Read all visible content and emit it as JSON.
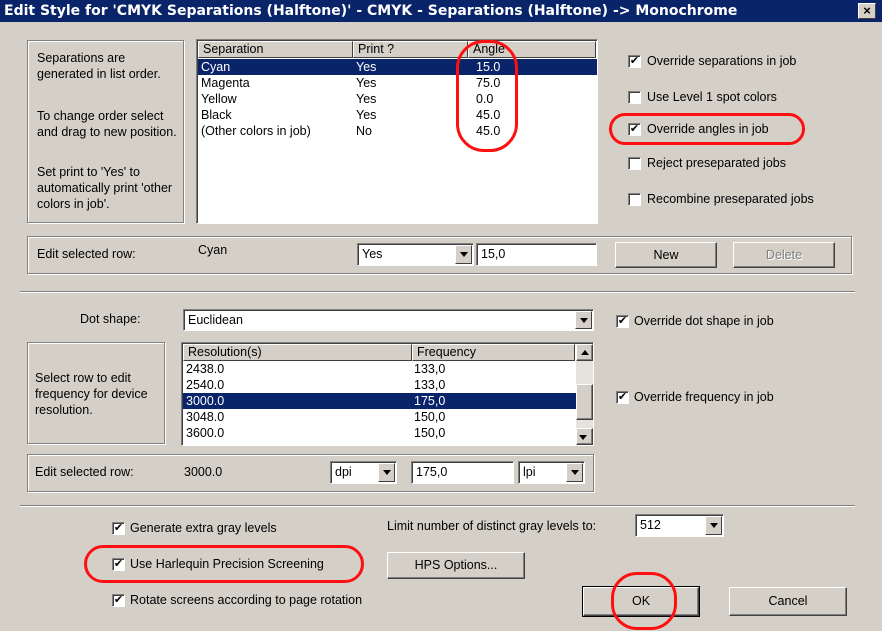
{
  "window": {
    "title": "Edit Style for 'CMYK Separations (Halftone)' - CMYK - Separations (Halftone) -> Monochrome",
    "close_glyph": "×"
  },
  "separations": {
    "info_text": [
      "Separations are generated in list order.",
      "To change order select and drag to new position.",
      "Set print to 'Yes' to automatically print 'other colors in job'."
    ],
    "columns": [
      "Separation",
      "Print ?",
      "Angle"
    ],
    "rows": [
      {
        "name": "Cyan",
        "print": "Yes",
        "angle": "15.0"
      },
      {
        "name": "Magenta",
        "print": "Yes",
        "angle": "75.0"
      },
      {
        "name": "Yellow",
        "print": "Yes",
        "angle": "0.0"
      },
      {
        "name": "Black",
        "print": "Yes",
        "angle": "45.0"
      },
      {
        "name": "(Other colors in job)",
        "print": "No",
        "angle": "45.0"
      }
    ],
    "selected_index": 0,
    "edit_row": {
      "label": "Edit selected row:",
      "name": "Cyan",
      "print_value": "Yes",
      "angle_value": "15,0",
      "new_label": "New",
      "delete_label": "Delete"
    },
    "options": [
      {
        "label": "Override separations in job",
        "checked": true
      },
      {
        "label": "Use Level 1 spot colors",
        "checked": false
      },
      {
        "label": "Override angles in job",
        "checked": true
      },
      {
        "label": "Reject preseparated jobs",
        "checked": false
      },
      {
        "label": "Recombine preseparated jobs",
        "checked": false
      }
    ]
  },
  "screening": {
    "dot_shape_label": "Dot shape:",
    "dot_shape_value": "Euclidean",
    "override_dot_shape": {
      "label": "Override dot shape in job",
      "checked": true
    },
    "info_text": [
      "Select row to edit frequency for device resolution."
    ],
    "columns": [
      "Resolution(s)",
      "Frequency"
    ],
    "rows": [
      {
        "resolution": "2438.0",
        "frequency": "133,0"
      },
      {
        "resolution": "2540.0",
        "frequency": "133,0"
      },
      {
        "resolution": "3000.0",
        "frequency": "175,0"
      },
      {
        "resolution": "3048.0",
        "frequency": "150,0"
      },
      {
        "resolution": "3600.0",
        "frequency": "150,0"
      }
    ],
    "selected_index": 2,
    "override_frequency": {
      "label": "Override frequency in job",
      "checked": true
    },
    "edit_row": {
      "label": "Edit selected row:",
      "resolution": "3000.0",
      "res_unit": "dpi",
      "frequency": "175,0",
      "freq_unit": "lpi"
    }
  },
  "bottom": {
    "generate_gray": {
      "label": "Generate extra gray levels",
      "checked": true
    },
    "use_hps": {
      "label": "Use Harlequin Precision Screening",
      "checked": true
    },
    "rotate_screens": {
      "label": "Rotate screens according to page rotation",
      "checked": true
    },
    "limit_label": "Limit number of distinct gray levels to:",
    "limit_value": "512",
    "hps_options_label": "HPS Options...",
    "ok_label": "OK",
    "cancel_label": "Cancel"
  },
  "check_glyph": "✔",
  "colors": {
    "selection": "#0a246a",
    "annotation": "#ff1010",
    "face": "#d4d0c8"
  }
}
